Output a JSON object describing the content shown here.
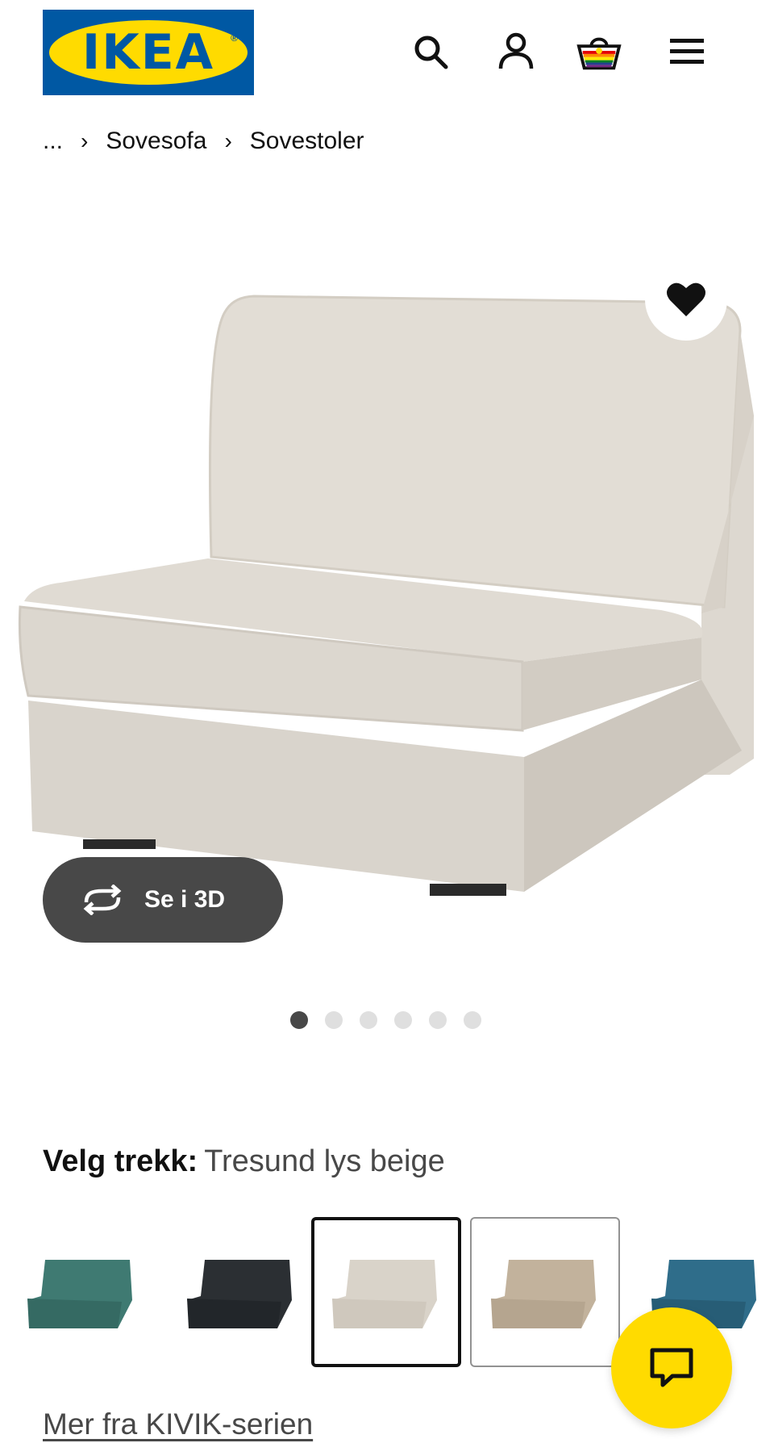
{
  "header": {
    "logo_text": "IKEA",
    "icons": [
      "search-icon",
      "account-icon",
      "basket-icon",
      "menu-icon"
    ]
  },
  "breadcrumb": {
    "ellipsis": "...",
    "items": [
      "Sovesofa",
      "Sovestoler"
    ]
  },
  "product": {
    "view_3d_label": "Se i 3D",
    "image_count": 6,
    "active_image": 1
  },
  "cover": {
    "label": "Velg trekk:",
    "value": "Tresund lys beige"
  },
  "swatch_colors": [
    "#3f7a72",
    "#2b2f33",
    "#d9d3c9",
    "#c2b29c",
    "#2f6d8a"
  ],
  "more_link": "Mer fra KIVIK-serien",
  "colors": {
    "ikea_blue": "#0058a3",
    "ikea_yellow": "#ffdb00",
    "dark_button": "#484848"
  }
}
